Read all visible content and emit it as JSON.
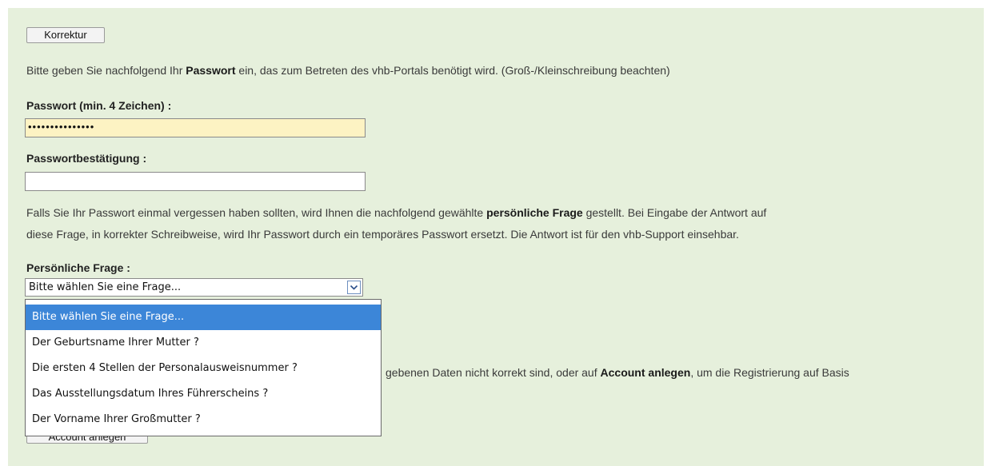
{
  "buttons": {
    "korrektur": "Korrektur",
    "account_anlegen": "Account anlegen"
  },
  "intro": {
    "before": "Bitte geben Sie nachfolgend Ihr ",
    "bold": "Passwort",
    "after": " ein, das zum Betreten des vhb-Portals benötigt wird. (Groß-/Kleinschreibung beachten)"
  },
  "password": {
    "label": "Passwort (min. 4 Zeichen) :",
    "value": "•••••••••••••••"
  },
  "confirm": {
    "label": "Passwortbestätigung :",
    "value": ""
  },
  "hint": {
    "line1_before": "Falls Sie Ihr Passwort einmal vergessen haben sollten, wird Ihnen die nachfolgend gewählte ",
    "line1_bold": "persönliche Frage",
    "line1_after": " gestellt. Bei Eingabe der Antwort auf",
    "line2": "diese Frage, in korrekter Schreibweise, wird Ihr Passwort durch ein temporäres Passwort ersetzt. Die Antwort ist für den vhb-Support einsehbar."
  },
  "question": {
    "label": "Persönliche Frage :",
    "selected": "Bitte wählen Sie eine Frage...",
    "options": [
      "Bitte wählen Sie eine Frage...",
      "Der Geburtsname Ihrer Mutter ?",
      "Die ersten 4 Stellen der Personalausweisnummer ?",
      "Das Ausstellungsdatum Ihres Führerscheins ?",
      "Der Vorname Ihrer Großmutter ?"
    ]
  },
  "bottom_text": {
    "before": "gebenen Daten nicht korrekt sind, oder auf ",
    "bold": "Account anlegen",
    "after": ", um die Registrierung auf Basis"
  },
  "colors": {
    "panel": "#e6f0dc",
    "password_fill": "#fdf3c3",
    "option_highlight": "#3c86d8"
  }
}
